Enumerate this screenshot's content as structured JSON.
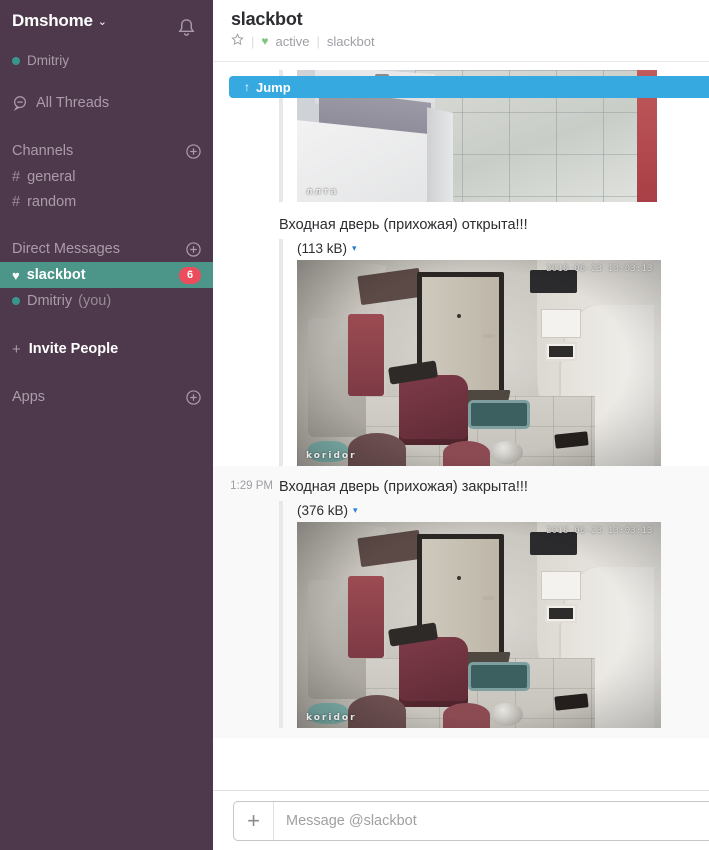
{
  "sidebar": {
    "team_name": "Dmshome",
    "team_caret": "⌄",
    "bell_icon": "bell-icon",
    "user": {
      "name": "Dmitriy",
      "presence": "active"
    },
    "threads": {
      "label": "All Threads",
      "icon": "threads-icon"
    },
    "channels": {
      "header": "Channels",
      "add_label": "⊕",
      "items": [
        {
          "hash": "#",
          "label": "general"
        },
        {
          "hash": "#",
          "label": "random"
        }
      ]
    },
    "direct_messages": {
      "header": "Direct Messages",
      "add_label": "⊕",
      "items": [
        {
          "icon": "♥",
          "label": "slackbot",
          "badge": "6",
          "active": true,
          "suffix": ""
        },
        {
          "icon": "●",
          "label": "Dmitriy",
          "badge": "",
          "active": false,
          "suffix": "(you)"
        }
      ]
    },
    "invite": {
      "plus": "+",
      "label": "Invite People"
    },
    "apps": {
      "header": "Apps",
      "add_label": "⊕"
    }
  },
  "header": {
    "title": "slackbot",
    "star_icon": "☆",
    "separator": "|",
    "heart_icon": "♥",
    "status": "active",
    "handle": "slackbot"
  },
  "jump": {
    "arrow": "↑",
    "label": "Jump"
  },
  "messages": [
    {
      "time": "",
      "text": "",
      "attachment": {
        "size": "",
        "caret": "▾",
        "photo": {
          "kind": "tiles",
          "timestamp": "",
          "watermark": "ллта"
        }
      },
      "partial": true
    },
    {
      "time": "",
      "text": "Входная дверь (прихожая) открыта!!!",
      "attachment": {
        "size": "(113 kB)",
        "caret": "▾",
        "photo": {
          "kind": "hallway",
          "timestamp": "2018-06-23 13:03:13",
          "watermark": "koridor"
        }
      },
      "partial": false
    },
    {
      "time": "1:29 PM",
      "text": "Входная дверь (прихожая) закрыта!!!",
      "attachment": {
        "size": "(376 kB)",
        "caret": "▾",
        "photo": {
          "kind": "hallway",
          "timestamp": "2018-06-23 13:03:13",
          "watermark": "koridor"
        }
      },
      "partial": false,
      "hovered": true
    }
  ],
  "composer": {
    "plus": "+",
    "placeholder": "Message @slackbot",
    "value": ""
  },
  "colors": {
    "sidebar_bg": "#4d394b",
    "active_dm": "#4c9689",
    "badge": "#eb4d5c",
    "jump_bar": "#36a9e1",
    "presence_green": "#38978d"
  }
}
